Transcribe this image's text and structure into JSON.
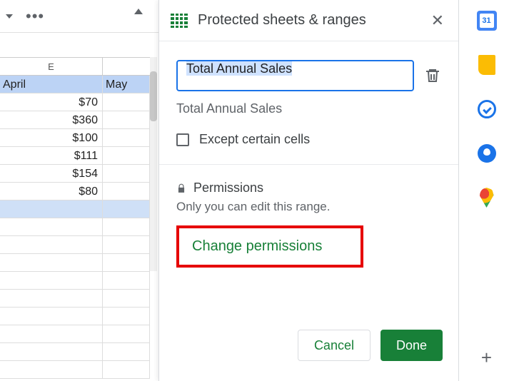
{
  "toolbar": {
    "more_label": "•••"
  },
  "columns": {
    "e": "E",
    "f": ""
  },
  "header_row": {
    "e": "April",
    "f": "May"
  },
  "rows": [
    {
      "e": "$70"
    },
    {
      "e": "$360"
    },
    {
      "e": "$100"
    },
    {
      "e": "$111"
    },
    {
      "e": "$154"
    },
    {
      "e": "$80"
    }
  ],
  "panel": {
    "title": "Protected sheets & ranges",
    "description_value": "Total Annual Sales",
    "range_name": "Total Annual Sales",
    "except_label": "Except certain cells",
    "permissions_title": "Permissions",
    "permissions_desc": "Only you can edit this range.",
    "change_label": "Change permissions",
    "cancel": "Cancel",
    "done": "Done"
  }
}
